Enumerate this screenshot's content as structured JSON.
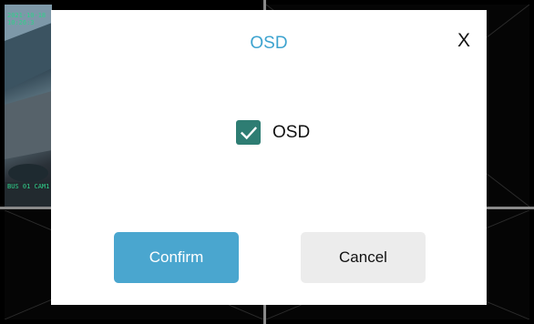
{
  "camera_grid": {
    "cam1_timestamp": "2021-10-18 10:26:3",
    "cam1_channel": "BUS 01 CAM1"
  },
  "dialog": {
    "title": "OSD",
    "close_label": "X",
    "osd_checkbox": {
      "label": "OSD",
      "checked": true
    },
    "confirm_label": "Confirm",
    "cancel_label": "Cancel"
  },
  "colors": {
    "title": "#3da3cf",
    "confirm_bg": "#4aa6cf",
    "checkbox_bg": "#2e7d73",
    "cancel_bg": "#ececec"
  }
}
